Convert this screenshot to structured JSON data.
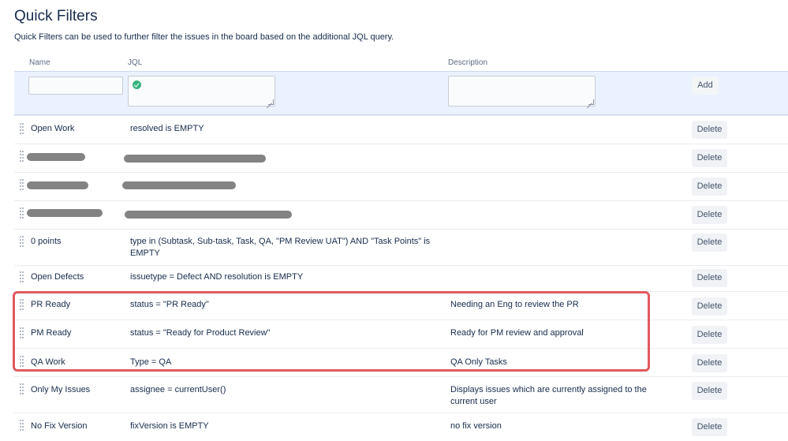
{
  "header": {
    "title": "Quick Filters",
    "description": "Quick Filters can be used to further filter the issues in the board based on the additional JQL query."
  },
  "columns": {
    "name": "Name",
    "jql": "JQL",
    "description": "Description"
  },
  "add_form": {
    "name_value": "",
    "jql_value": "",
    "description_value": "",
    "jql_status_icon": "check-circle-icon",
    "add_label": "Add"
  },
  "filters": [
    {
      "name": "Open Work",
      "jql": "resolved is EMPTY",
      "description": "",
      "redacted": false
    },
    {
      "name": "",
      "jql": "",
      "description": "",
      "redacted": true
    },
    {
      "name": "",
      "jql": "",
      "description": "",
      "redacted": true
    },
    {
      "name": "",
      "jql": "",
      "description": "",
      "redacted": true
    },
    {
      "name": "0 points",
      "jql": "type in (Subtask, Sub-task, Task, QA, \"PM Review UAT\") AND \"Task Points\" is EMPTY",
      "description": "",
      "redacted": false
    },
    {
      "name": "Open Defects",
      "jql": "issuetype = Defect AND resolution is EMPTY",
      "description": "",
      "redacted": false
    },
    {
      "name": "PR Ready",
      "jql": "status = \"PR Ready\"",
      "description": "Needing an Eng to review the PR",
      "redacted": false
    },
    {
      "name": "PM Ready",
      "jql": "status = \"Ready for Product Review\"",
      "description": "Ready for PM review and approval",
      "redacted": false
    },
    {
      "name": "QA Work",
      "jql": "Type = QA",
      "description": "QA Only Tasks",
      "redacted": false
    },
    {
      "name": "Only My Issues",
      "jql": "assignee = currentUser()",
      "description": "Displays issues which are currently assigned to the current user",
      "redacted": false
    },
    {
      "name": "No Fix Version",
      "jql": "fixVersion is EMPTY",
      "description": "no fix version",
      "redacted": false
    }
  ],
  "delete_label": "Delete",
  "colors": {
    "accent_text": "#172b4d",
    "highlight_border": "#e05a5f",
    "add_row_bg": "#ebf2ff",
    "valid_green": "#36b37e"
  }
}
